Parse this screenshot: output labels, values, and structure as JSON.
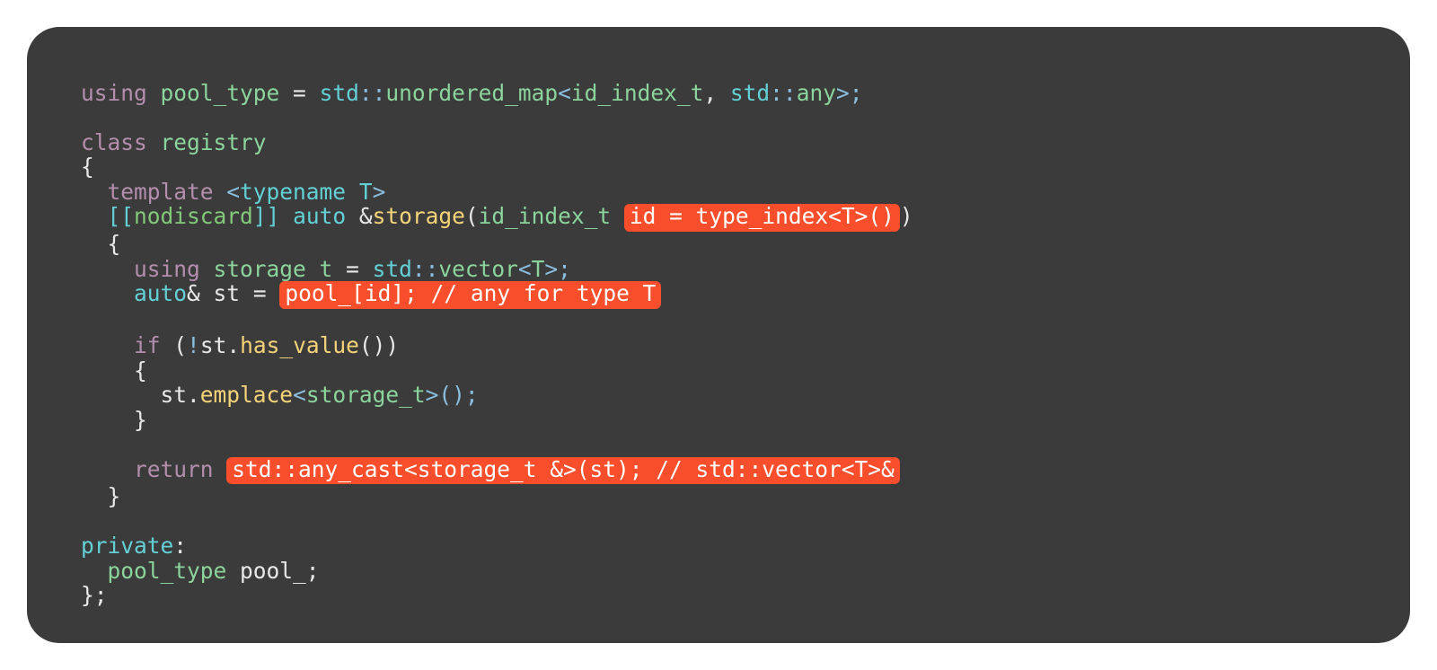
{
  "code": {
    "line1": {
      "using": "using",
      "pool_type": "pool_type",
      "eq": " = ",
      "std1": "std",
      "cc1": "::",
      "umap": "unordered_map",
      "lt": "<",
      "id_index_t": "id_index_t",
      "comma": ", ",
      "std2": "std",
      "cc2": "::",
      "any": "any",
      "gtsc": ">;"
    },
    "line3": {
      "class": "class",
      "registry": "registry"
    },
    "line4": {
      "brace": "{"
    },
    "line5": {
      "indent": "  ",
      "template": "template",
      "lt": " <",
      "typename": "typename",
      "T": " T",
      "gt": ">"
    },
    "line6": {
      "indent": "  ",
      "lb": "[[",
      "nodiscard": "nodiscard",
      "rb": "]]",
      "auto": " auto",
      "amp": " &",
      "storage": "storage",
      "lp": "(",
      "id_index_t": "id_index_t",
      "hl": "id = type_index<T>()",
      "rp": ")"
    },
    "line7": {
      "indent": "  ",
      "brace": "{"
    },
    "line8": {
      "indent": "    ",
      "using": "using",
      "storage_t": "storage_t",
      "eq": " = ",
      "std": "std",
      "cc": "::",
      "vector": "vector",
      "lt": "<",
      "T": "T",
      "gtsc": ">;"
    },
    "line9": {
      "indent": "    ",
      "auto": "auto",
      "amp": "&",
      "st": " st",
      "eq": " = ",
      "hl": "pool_[id]; // any for type T"
    },
    "line11": {
      "indent": "    ",
      "if": "if",
      "lp": " (",
      "not": "!",
      "st": "st",
      "dot": ".",
      "has_value": "has_value",
      "rp": "())"
    },
    "line12": {
      "indent": "    ",
      "brace": "{"
    },
    "line13": {
      "indent": "      ",
      "st": "st",
      "dot": ".",
      "emplace": "emplace",
      "lt": "<",
      "storage_t": "storage_t",
      "gtend": ">();"
    },
    "line14": {
      "indent": "    ",
      "brace": "}"
    },
    "line16": {
      "indent": "    ",
      "return": "return",
      "sp": " ",
      "hl": "std::any_cast<storage_t &>(st); // std::vector<T>&"
    },
    "line17": {
      "indent": "  ",
      "brace": "}"
    },
    "line19": {
      "private": "private",
      "colon": ":"
    },
    "line20": {
      "indent": "  ",
      "pool_type": "pool_type",
      "pool_": " pool_",
      "sc": ";"
    },
    "line21": {
      "end": "};"
    }
  }
}
